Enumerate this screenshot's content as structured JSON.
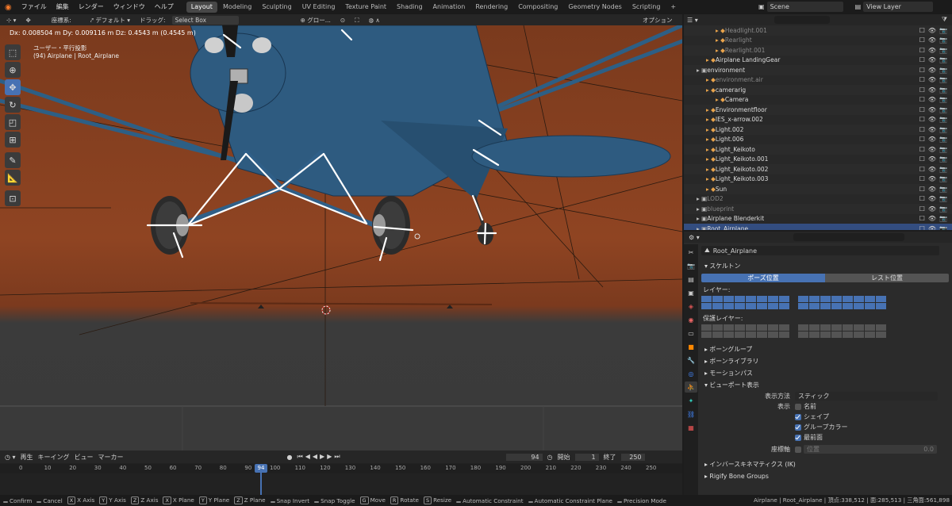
{
  "menu": {
    "items": [
      "ファイル",
      "編集",
      "レンダー",
      "ウィンドウ",
      "ヘルプ"
    ]
  },
  "workspaces": [
    "Layout",
    "Modeling",
    "Sculpting",
    "UV Editing",
    "Texture Paint",
    "Shading",
    "Animation",
    "Rendering",
    "Compositing",
    "Geometry Nodes",
    "Scripting"
  ],
  "scene": {
    "name": "Scene",
    "view_layer": "View Layer"
  },
  "vp_header": {
    "coord": "座標系:",
    "orientation": "デフォルト",
    "drag": "ドラッグ:",
    "drag_value": "Select Box",
    "global": "グロー...",
    "options": "オプション"
  },
  "vp_overlay": {
    "delta": "Dx: 0.008504 m   Dy: 0.009116 m   Dz: 0.4543 m (0.4545 m)",
    "view_name": "ユーザー・平行投影",
    "object": "(94) Airplane | Root_Airplane"
  },
  "outliner": {
    "rows": [
      {
        "name": "Headlight.001",
        "indent": 3,
        "gray": true
      },
      {
        "name": "Rearlight",
        "indent": 3,
        "gray": true
      },
      {
        "name": "Rearlight.001",
        "indent": 3,
        "gray": true
      },
      {
        "name": "Airplane LandingGear",
        "indent": 2,
        "gray": false
      },
      {
        "name": "environment",
        "indent": 1,
        "gray": false
      },
      {
        "name": "environment.air",
        "indent": 2,
        "gray": true
      },
      {
        "name": "camerarig",
        "indent": 2,
        "gray": false
      },
      {
        "name": "Camera",
        "indent": 3,
        "gray": false
      },
      {
        "name": "Environmentfloor",
        "indent": 2,
        "gray": false
      },
      {
        "name": "IES_x-arrow.002",
        "indent": 2,
        "gray": false
      },
      {
        "name": "Light.002",
        "indent": 2,
        "gray": false
      },
      {
        "name": "Light.006",
        "indent": 2,
        "gray": false
      },
      {
        "name": "Light_Keikoto",
        "indent": 2,
        "gray": false
      },
      {
        "name": "Light_Keikoto.001",
        "indent": 2,
        "gray": false
      },
      {
        "name": "Light_Keikoto.002",
        "indent": 2,
        "gray": false
      },
      {
        "name": "Light_Keikoto.003",
        "indent": 2,
        "gray": false
      },
      {
        "name": "Sun",
        "indent": 2,
        "gray": false
      },
      {
        "name": "LOD2",
        "indent": 1,
        "gray": true
      },
      {
        "name": "blueprint",
        "indent": 1,
        "gray": true
      },
      {
        "name": "Airplane Blenderkit",
        "indent": 1,
        "gray": false
      },
      {
        "name": "Root_Airplane",
        "indent": 1,
        "gray": false
      }
    ]
  },
  "props": {
    "object": "Root_Airplane",
    "skeleton": "スケルトン",
    "pose_position": "ポーズ位置",
    "rest_position": "レスト位置",
    "layers": "レイヤー:",
    "protected_layers": "保護レイヤー:",
    "panels": [
      "ボーングループ",
      "ボーンライブラリ",
      "モーションパス"
    ],
    "viewport_display": "ビューポート表示",
    "display_as_label": "表示方法",
    "display_as_value": "スティック",
    "show_label": "表示",
    "opts": [
      {
        "label": "名前",
        "on": false
      },
      {
        "label": "シェイプ",
        "on": true
      },
      {
        "label": "グループカラー",
        "on": true
      },
      {
        "label": "最前面",
        "on": true
      }
    ],
    "axes_label": "座標軸",
    "position_label": "位置",
    "position_value": "0.0",
    "ik": "インバースキネマティクス (IK)",
    "rigify": "Rigify Bone Groups"
  },
  "timeline": {
    "playback": "再生",
    "keying": "キーイング",
    "view": "ビュー",
    "marker": "マーカー",
    "current": "94",
    "start_label": "開始",
    "start": "1",
    "end_label": "終了",
    "end": "250",
    "ticks": [
      "0",
      "10",
      "20",
      "30",
      "40",
      "50",
      "60",
      "70",
      "80",
      "90",
      "100",
      "110",
      "120",
      "130",
      "140",
      "150",
      "160",
      "170",
      "180",
      "190",
      "200",
      "210",
      "220",
      "230",
      "240",
      "250"
    ]
  },
  "status": {
    "items": [
      [
        "",
        "Confirm"
      ],
      [
        "",
        "Cancel"
      ],
      [
        "X",
        "X Axis"
      ],
      [
        "Y",
        "Y Axis"
      ],
      [
        "Z",
        "Z Axis"
      ],
      [
        "X",
        "X Plane"
      ],
      [
        "Y",
        "Y Plane"
      ],
      [
        "Z",
        "Z Plane"
      ],
      [
        "",
        "Snap Invert"
      ],
      [
        "",
        "Snap Toggle"
      ],
      [
        "G",
        "Move"
      ],
      [
        "R",
        "Rotate"
      ],
      [
        "S",
        "Resize"
      ],
      [
        "",
        "Automatic Constraint"
      ],
      [
        "",
        "Automatic Constraint Plane"
      ],
      [
        "",
        "Precision Mode"
      ]
    ],
    "info": "Airplane | Root_Airplane | 頂点:338,512 | 面:285,513 | 三角面:561,898 | オブ"
  },
  "colors": {
    "accent": "#4772b3",
    "bg_orange": "#8a3f20"
  }
}
